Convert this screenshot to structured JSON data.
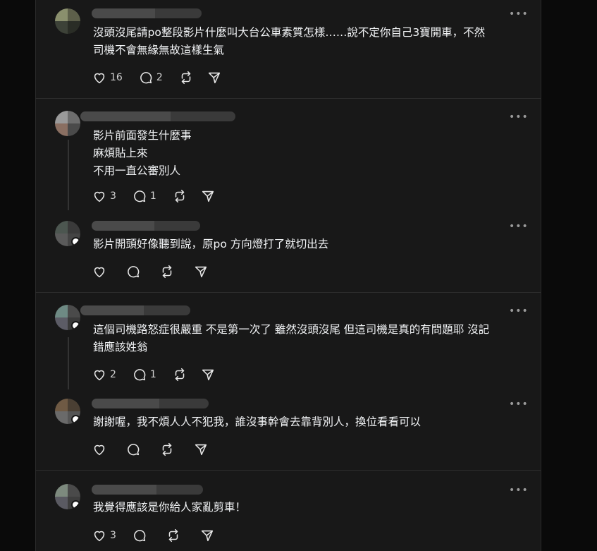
{
  "posts": [
    {
      "text": "沒頭沒尾請po整段影片什麼叫大台公車素質怎樣……說不定你自己3寶開車，不然\n司機不會無緣無故這樣生氣",
      "likes": "16",
      "replies": "2",
      "more_icon": "•••"
    },
    {
      "text": "影片前面發生什麼事\n麻煩貼上來\n不用一直公審別人",
      "likes": "3",
      "replies": "1",
      "more_icon": "•••"
    },
    {
      "text": "影片開頭好像聽到說，原po 方向燈打了就切出去",
      "likes": "",
      "replies": "",
      "more_icon": "•••"
    },
    {
      "text": "這個司機路怒症很嚴重 不是第一次了 雖然沒頭沒尾 但這司機是真的有問題耶 沒記\n錯應該姓翁",
      "likes": "2",
      "replies": "1",
      "more_icon": "•••"
    },
    {
      "text": "謝謝喔，我不煩人人不犯我，誰沒事幹會去靠背別人，換位看看可以",
      "likes": "",
      "replies": "",
      "more_icon": "•••"
    },
    {
      "text": "我覺得應該是你給人家亂剪車！",
      "likes": "3",
      "replies": "",
      "more_icon": "•••"
    }
  ],
  "icons": [
    "heart-icon",
    "comment-icon",
    "repost-icon",
    "send-icon",
    "more-icon"
  ],
  "colors": {
    "background": "#181818",
    "text": "#f3f5f7",
    "muted": "#9a9a9a",
    "divider": "#2d2d2d"
  }
}
